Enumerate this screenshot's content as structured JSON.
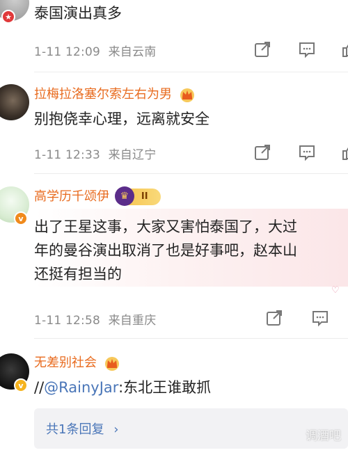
{
  "comments": [
    {
      "text": "泰国演出真多",
      "time": "1-11 12:09",
      "location": "来自云南"
    },
    {
      "username": "拉梅拉洛塞尔索左右为男",
      "text": "别抱侥幸心理，远离就安全",
      "time": "1-11 12:33",
      "location": "来自辽宁"
    },
    {
      "username": "高学历千颂伊",
      "level_badge": "II",
      "text_lines": [
        "出了王星这事，大家又害怕泰国了，大过",
        "年的曼谷演出取消了也是好事吧，赵本山",
        "还挺有担当的"
      ],
      "time": "1-11 12:58",
      "location": "来自重庆"
    },
    {
      "username": "无差别社会",
      "text_prefix": "//",
      "mention": "@RainyJar",
      "text_suffix": ":东北王谁敢抓",
      "reply_summary": "共1条回复",
      "reply_chevron": "›"
    }
  ],
  "icons": {
    "share": "share-icon",
    "comment": "comment-icon",
    "like": "like-icon"
  },
  "watermark": "调酒吧"
}
